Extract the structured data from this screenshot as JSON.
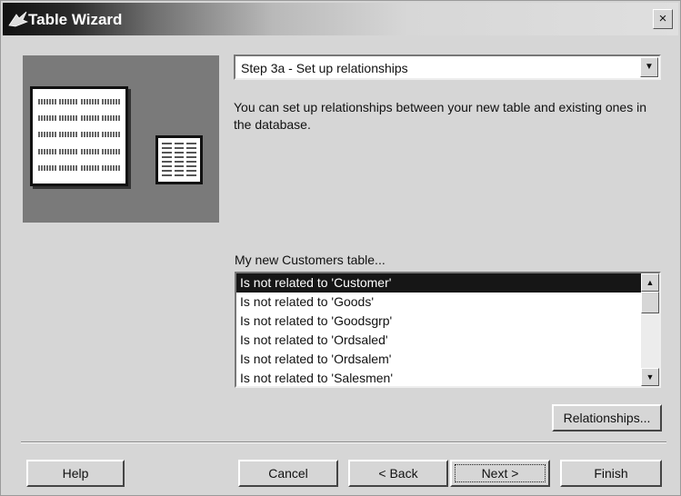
{
  "window": {
    "title": "Table Wizard",
    "close_glyph": "×"
  },
  "step_selector": {
    "value": "Step 3a - Set up relationships",
    "arrow_glyph": "▼"
  },
  "description": "You can set up relationships between your new table and existing ones in the database.",
  "relationships_list": {
    "label": "My new Customers table...",
    "items": [
      {
        "text": "Is not related to 'Customer'",
        "selected": true
      },
      {
        "text": "Is not related to 'Goods'",
        "selected": false
      },
      {
        "text": "Is not related to 'Goodsgrp'",
        "selected": false
      },
      {
        "text": "Is not related to 'Ordsaled'",
        "selected": false
      },
      {
        "text": "Is not related to 'Ordsalem'",
        "selected": false
      },
      {
        "text": "Is not related to 'Salesmen'",
        "selected": false
      }
    ],
    "scroll_up_glyph": "▲",
    "scroll_down_glyph": "▼"
  },
  "buttons": {
    "relationships": "Relationships...",
    "help": "Help",
    "cancel": "Cancel",
    "back": "< Back",
    "next": "Next >",
    "finish": "Finish"
  },
  "icons": {
    "title": "table-wizard-icon",
    "illustration": "table-illustration"
  }
}
